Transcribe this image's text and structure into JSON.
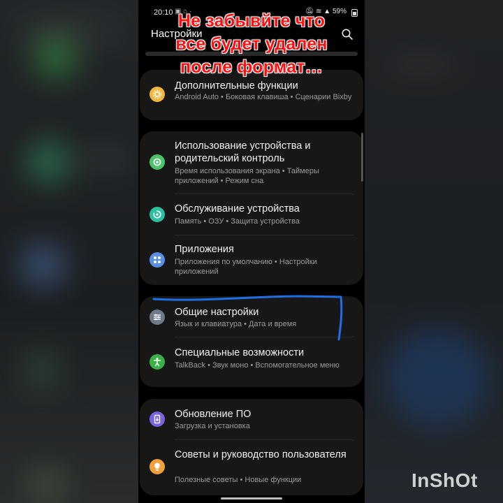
{
  "status": {
    "time": "20:10",
    "battery": "59%"
  },
  "header": {
    "title": "Настройки"
  },
  "overlay_caption": [
    "Не забывйте что",
    "все будет удален",
    "после формат…"
  ],
  "sections": [
    [
      {
        "title": "Дополнительные функции",
        "subtitle": "Android Auto  •  Боковая клавиша  •  Сценарии Bixby",
        "icon": "star-gear-icon",
        "color": "#f2b63c"
      }
    ],
    [
      {
        "title": "Использование устройства и родительский контроль",
        "subtitle": "Время использования экрана  •  Таймеры приложений  •  Режим сна",
        "icon": "digital-wellbeing-icon",
        "color": "#4cc46a"
      },
      {
        "title": "Обслуживание устройства",
        "subtitle": "Память  •  ОЗУ  •  Защита устройства",
        "icon": "device-care-icon",
        "color": "#2cc0a0"
      },
      {
        "title": "Приложения",
        "subtitle": "Приложения по умолчанию  •  Настройки приложений",
        "icon": "apps-icon",
        "color": "#5b8fe6"
      }
    ],
    [
      {
        "title": "Общие настройки",
        "subtitle": "Язык и клавиатура  •  Дата и время",
        "icon": "sliders-icon",
        "color": "#6c7a8a"
      },
      {
        "title": "Специальные возможности",
        "subtitle": "TalkBack  •  Звук моно  •  Вспомогательное меню",
        "icon": "accessibility-icon",
        "color": "#3cb048"
      }
    ],
    [
      {
        "title": "Обновление ПО",
        "subtitle": "Загрузка и установка",
        "icon": "software-update-icon",
        "color": "#7a63e0"
      },
      {
        "title": "Советы и руководство пользователя",
        "subtitle": "Полезные советы  •  Новые функции",
        "icon": "lightbulb-icon",
        "color": "#f2a03c"
      }
    ]
  ],
  "watermark": "InShOt"
}
